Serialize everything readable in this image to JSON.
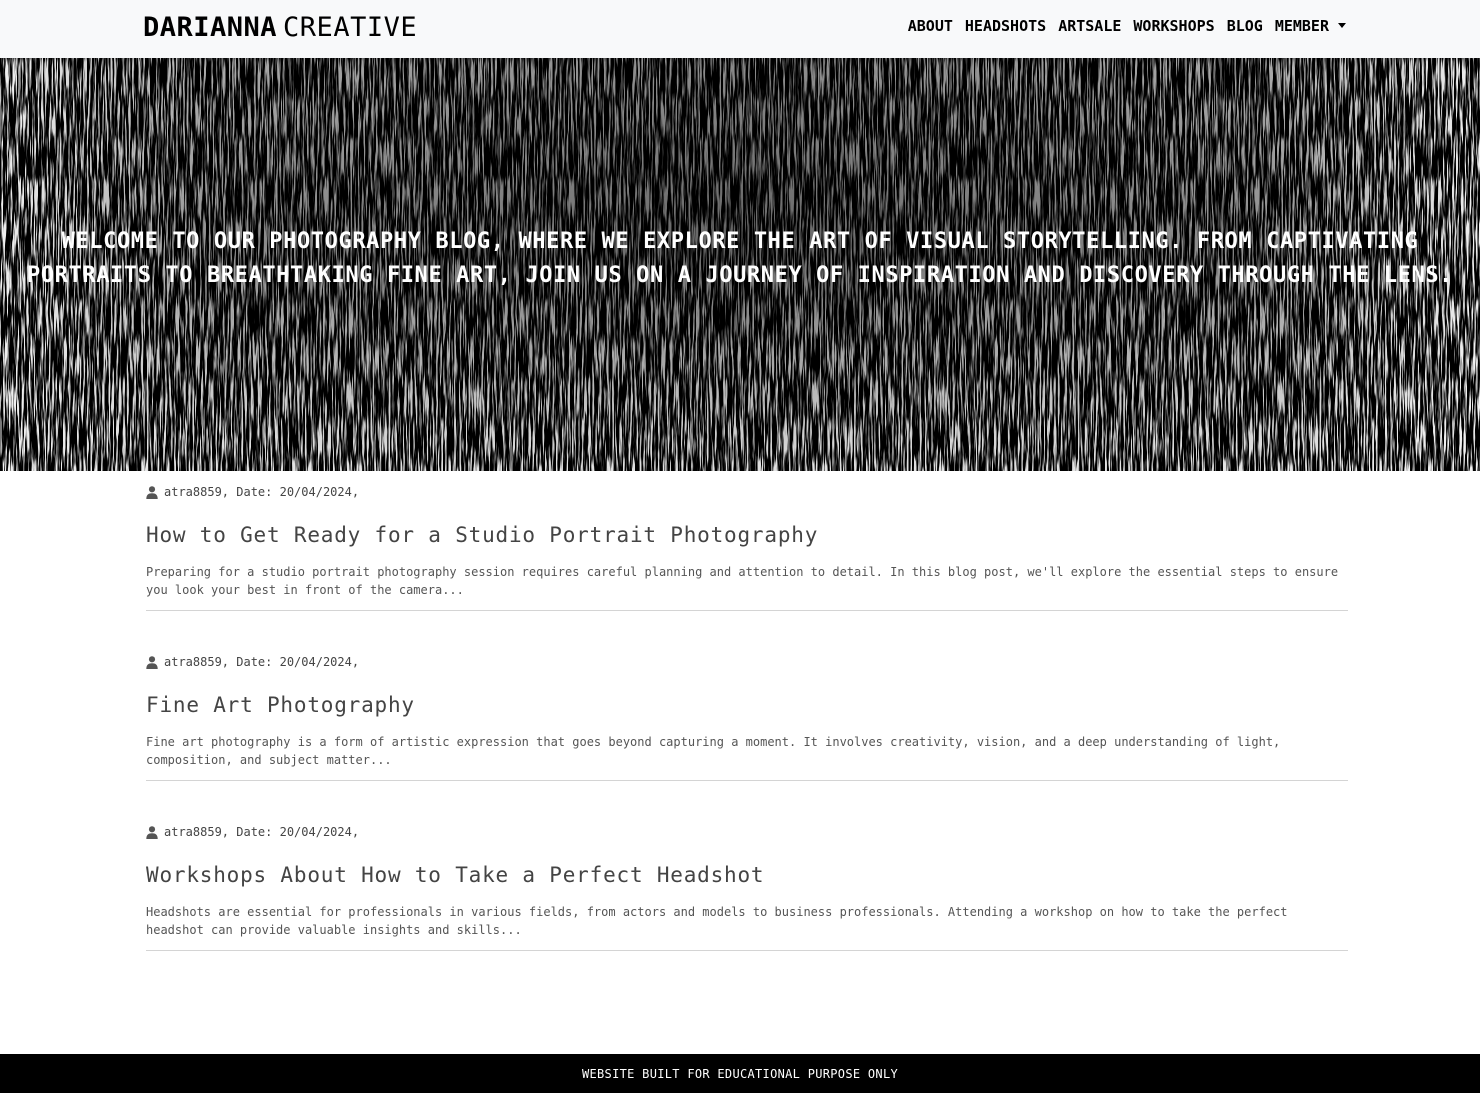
{
  "navbar": {
    "brand_bold": "DARIANNA",
    "brand_light": "CREATIVE",
    "links": [
      {
        "label": "ABOUT"
      },
      {
        "label": "HEADSHOTS"
      },
      {
        "label": "ARTSALE"
      },
      {
        "label": "WORKSHOPS"
      },
      {
        "label": "BLOG"
      },
      {
        "label": "MEMBER"
      }
    ]
  },
  "hero": {
    "text": "Welcome to our photography blog, where we explore the art of visual storytelling. From captivating portraits to breathtaking fine art, join us on a journey of inspiration and discovery through the lens."
  },
  "posts": [
    {
      "meta": "atra8859, Date: 20/04/2024,",
      "title": "How to Get Ready for a Studio Portrait Photography",
      "excerpt": "Preparing for a studio portrait photography session requires careful planning and attention to detail. In this blog post, we'll explore the essential steps to ensure you look your best in front of the camera..."
    },
    {
      "meta": "atra8859, Date: 20/04/2024,",
      "title": "Fine Art Photography",
      "excerpt": "Fine art photography is a form of artistic expression that goes beyond capturing a moment. It involves creativity, vision, and a deep understanding of light, composition, and subject matter..."
    },
    {
      "meta": "atra8859, Date: 20/04/2024,",
      "title": "Workshops About How to Take a Perfect Headshot",
      "excerpt": "Headshots are essential for professionals in various fields, from actors and models to business professionals. Attending a workshop on how to take the perfect headshot can provide valuable insights and skills..."
    }
  ],
  "footer": {
    "text": "WEBSITE BUILT FOR EDUCATIONAL PURPOSE ONLY"
  },
  "icons": {
    "user": "user-icon",
    "dropdown": "caret-down-icon"
  },
  "colors": {
    "navbar_bg": "#f8f9fa",
    "hero_bg": "#000000",
    "footer_bg": "#000000"
  }
}
